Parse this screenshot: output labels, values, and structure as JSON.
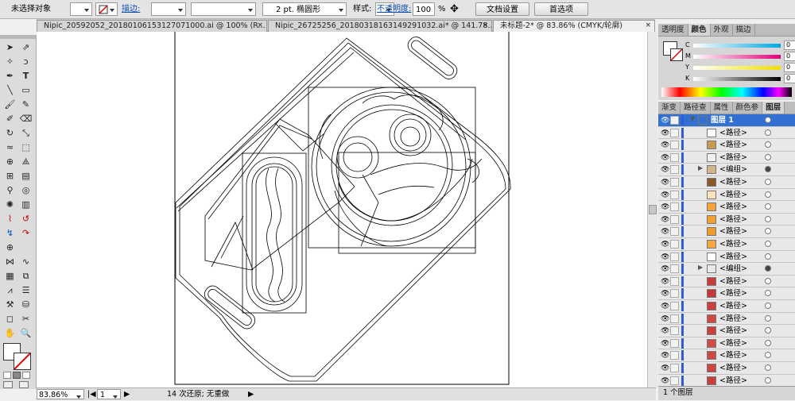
{
  "control_bar": {
    "selection_status": "未选择对象",
    "stroke_label": "描边:",
    "brush_label": "2 pt. 椭圆形",
    "style_label": "样式:",
    "opacity_label": "不透明度:",
    "opacity_value": "100",
    "percent": "%",
    "doc_setup_button": "文档设置",
    "prefs_button": "首选项"
  },
  "doc_tabs": [
    {
      "label": "Nipic_20592052_20180106153127071000.ai @ 100% (R...",
      "close": "×"
    },
    {
      "label": "Nipic_26725256_20180318163149291032.ai* @ 141.78...",
      "close": "×"
    },
    {
      "label": "未标题-2* @ 83.86% (CMYK/轮廓)",
      "close": "×"
    }
  ],
  "status_bar": {
    "zoom": "83.86%",
    "page": "1",
    "undo_info": "14 次还原; 无重做"
  },
  "color_panel": {
    "tabs": [
      "透明度",
      "颜色",
      "外观",
      "描边"
    ],
    "channels": [
      {
        "name": "C",
        "value": "0"
      },
      {
        "name": "M",
        "value": "0"
      },
      {
        "name": "Y",
        "value": "0"
      },
      {
        "name": "K",
        "value": "0"
      }
    ],
    "percent": "%"
  },
  "layers_panel": {
    "tabs": [
      "渐变",
      "路径查",
      "属性",
      "颜色参",
      "图层"
    ],
    "rows": [
      {
        "label": "图层 1",
        "kind": "layer",
        "thumb": "#3271d2"
      },
      {
        "label": "<路径>",
        "kind": "path",
        "thumb": "#ffffff"
      },
      {
        "label": "<路径>",
        "kind": "path",
        "thumb": "#c79a52"
      },
      {
        "label": "<路径>",
        "kind": "path",
        "thumb": "#f2f2f2"
      },
      {
        "label": "<编组>",
        "kind": "group",
        "thumb": "#d4b48a"
      },
      {
        "label": "<路径>",
        "kind": "path",
        "thumb": "#8a5a2b"
      },
      {
        "label": "<路径>",
        "kind": "path",
        "thumb": "#fbe2bd"
      },
      {
        "label": "<路径>",
        "kind": "path",
        "thumb": "#f3a33a"
      },
      {
        "label": "<路径>",
        "kind": "path",
        "thumb": "#f0a030"
      },
      {
        "label": "<路径>",
        "kind": "path",
        "thumb": "#ee9b2e"
      },
      {
        "label": "<路径>",
        "kind": "path",
        "thumb": "#f5a83e"
      },
      {
        "label": "<路径>",
        "kind": "path",
        "thumb": "#ffffff"
      },
      {
        "label": "<编组>",
        "kind": "group",
        "thumb": "#e8e8e8"
      },
      {
        "label": "<路径>",
        "kind": "path",
        "thumb": "#c83b3b"
      },
      {
        "label": "<路径>",
        "kind": "path",
        "thumb": "#c43a3a"
      },
      {
        "label": "<路径>",
        "kind": "path",
        "thumb": "#c9423f"
      },
      {
        "label": "<路径>",
        "kind": "path",
        "thumb": "#cf4a45"
      },
      {
        "label": "<路径>",
        "kind": "path",
        "thumb": "#c84040"
      },
      {
        "label": "<路径>",
        "kind": "path",
        "thumb": "#d24c46"
      },
      {
        "label": "<路径>",
        "kind": "path",
        "thumb": "#cd4a44"
      },
      {
        "label": "<路径>",
        "kind": "path",
        "thumb": "#cc4540"
      },
      {
        "label": "<路径>",
        "kind": "path",
        "thumb": "#c83f3b"
      }
    ],
    "footer": "1 个图层"
  }
}
